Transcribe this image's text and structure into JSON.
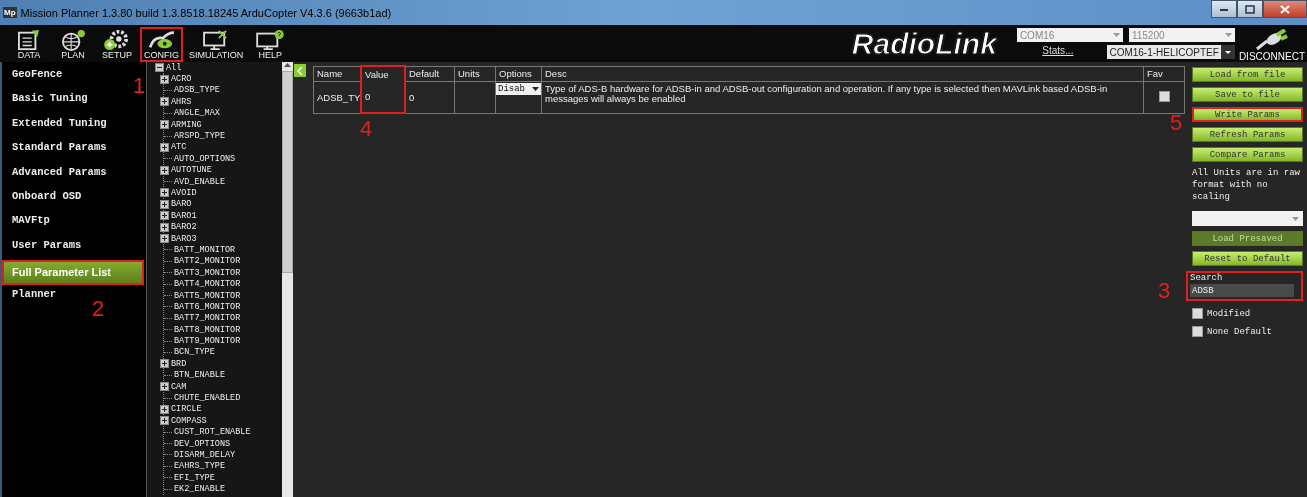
{
  "window": {
    "title": "Mission Planner 1.3.80 build 1.3.8518.18245 ArduCopter V4.3.6 (9663b1ad)",
    "app_icon": "Mp"
  },
  "toolbar": [
    {
      "label": "DATA",
      "highlighted": false
    },
    {
      "label": "PLAN",
      "highlighted": false
    },
    {
      "label": "SETUP",
      "highlighted": false
    },
    {
      "label": "CONFIG",
      "highlighted": true
    },
    {
      "label": "SIMULATION",
      "highlighted": false
    },
    {
      "label": "HELP",
      "highlighted": false
    }
  ],
  "brand": "RadioLink",
  "connection": {
    "port": "COM16",
    "baud": "115200",
    "stats_link": "Stats...",
    "vehicle": "COM16-1-HELICOPTEF",
    "disconnect": "DISCONNECT"
  },
  "sidebar": {
    "items": [
      {
        "label": "GeoFence",
        "selected": false
      },
      {
        "label": "Basic Tuning",
        "selected": false
      },
      {
        "label": "Extended Tuning",
        "selected": false
      },
      {
        "label": "Standard Params",
        "selected": false
      },
      {
        "label": "Advanced Params",
        "selected": false
      },
      {
        "label": "Onboard OSD",
        "selected": false
      },
      {
        "label": "MAVFtp",
        "selected": false
      },
      {
        "label": "User Params",
        "selected": false
      },
      {
        "label": "Full Parameter List",
        "selected": true
      },
      {
        "label": "Planner",
        "selected": false
      }
    ]
  },
  "tree": {
    "label": "All",
    "expanded": true,
    "children": [
      {
        "label": "ACRO",
        "kind": "group",
        "expanded": false
      },
      {
        "label": "ADSB_TYPE",
        "kind": "leaf"
      },
      {
        "label": "AHRS",
        "kind": "group",
        "expanded": false
      },
      {
        "label": "ANGLE_MAX",
        "kind": "leaf"
      },
      {
        "label": "ARMING",
        "kind": "group",
        "expanded": false
      },
      {
        "label": "ARSPD_TYPE",
        "kind": "leaf"
      },
      {
        "label": "ATC",
        "kind": "group",
        "expanded": false
      },
      {
        "label": "AUTO_OPTIONS",
        "kind": "leaf"
      },
      {
        "label": "AUTOTUNE",
        "kind": "group",
        "expanded": false
      },
      {
        "label": "AVD_ENABLE",
        "kind": "leaf"
      },
      {
        "label": "AVOID",
        "kind": "group",
        "expanded": false
      },
      {
        "label": "BARO",
        "kind": "group",
        "expanded": false
      },
      {
        "label": "BARO1",
        "kind": "group",
        "expanded": false
      },
      {
        "label": "BARO2",
        "kind": "group",
        "expanded": false
      },
      {
        "label": "BARO3",
        "kind": "group",
        "expanded": false
      },
      {
        "label": "BATT_MONITOR",
        "kind": "leaf"
      },
      {
        "label": "BATT2_MONITOR",
        "kind": "leaf"
      },
      {
        "label": "BATT3_MONITOR",
        "kind": "leaf"
      },
      {
        "label": "BATT4_MONITOR",
        "kind": "leaf"
      },
      {
        "label": "BATT5_MONITOR",
        "kind": "leaf"
      },
      {
        "label": "BATT6_MONITOR",
        "kind": "leaf"
      },
      {
        "label": "BATT7_MONITOR",
        "kind": "leaf"
      },
      {
        "label": "BATT8_MONITOR",
        "kind": "leaf"
      },
      {
        "label": "BATT9_MONITOR",
        "kind": "leaf"
      },
      {
        "label": "BCN_TYPE",
        "kind": "leaf"
      },
      {
        "label": "BRD",
        "kind": "group",
        "expanded": false
      },
      {
        "label": "BTN_ENABLE",
        "kind": "leaf"
      },
      {
        "label": "CAM",
        "kind": "group",
        "expanded": false
      },
      {
        "label": "CHUTE_ENABLED",
        "kind": "leaf"
      },
      {
        "label": "CIRCLE",
        "kind": "group",
        "expanded": false
      },
      {
        "label": "COMPASS",
        "kind": "group",
        "expanded": false
      },
      {
        "label": "CUST_ROT_ENABLE",
        "kind": "leaf"
      },
      {
        "label": "DEV_OPTIONS",
        "kind": "leaf"
      },
      {
        "label": "DISARM_DELAY",
        "kind": "leaf"
      },
      {
        "label": "EAHRS_TYPE",
        "kind": "leaf"
      },
      {
        "label": "EFI_TYPE",
        "kind": "leaf"
      },
      {
        "label": "EK2_ENABLE",
        "kind": "leaf"
      }
    ]
  },
  "table": {
    "columns": [
      {
        "label": "Name",
        "highlighted": false
      },
      {
        "label": "Value",
        "highlighted": true
      },
      {
        "label": "Default",
        "highlighted": false
      },
      {
        "label": "Units",
        "highlighted": false
      },
      {
        "label": "Options",
        "highlighted": false
      },
      {
        "label": "Desc",
        "highlighted": false
      },
      {
        "label": "Fav",
        "highlighted": false
      }
    ],
    "rows": [
      {
        "name": "ADSB_TY",
        "value": "0",
        "default": "0",
        "option": "Disab",
        "desc": "Type of ADS-B hardware for ADSB-in and ADSB-out configuration and operation. If any type is selected then MAVLink based ADSB-in messages will always be enabled",
        "fav": false
      }
    ]
  },
  "actions": [
    {
      "label": "Load from file",
      "disabled": false,
      "highlighted": false
    },
    {
      "label": "Save to file",
      "disabled": false,
      "highlighted": false
    },
    {
      "label": "Write Params",
      "disabled": false,
      "highlighted": true
    },
    {
      "label": "Refresh Params",
      "disabled": false,
      "highlighted": false
    },
    {
      "label": "Compare Params",
      "disabled": false,
      "highlighted": false
    }
  ],
  "units_note": "All Units are in raw format with no scaling",
  "presets": [
    {
      "label": "Load Presaved",
      "disabled": true,
      "highlighted": false
    },
    {
      "label": "Reset to Default",
      "disabled": false,
      "highlighted": false
    }
  ],
  "search": {
    "label": "Search",
    "value": "ADSB",
    "highlighted": true
  },
  "filters": [
    {
      "label": "Modified",
      "checked": false
    },
    {
      "label": "None Default",
      "checked": false
    }
  ],
  "callouts": [
    "1",
    "2",
    "3",
    "4",
    "5"
  ]
}
